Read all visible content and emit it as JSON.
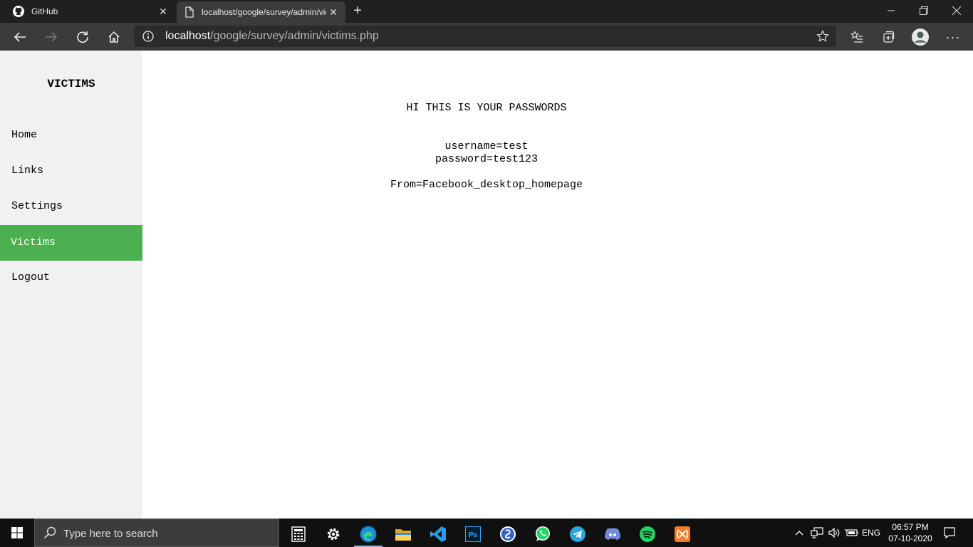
{
  "browser": {
    "tabs": [
      {
        "title": "GitHub",
        "icon": "github-icon"
      },
      {
        "title": "localhost/google/survey/admin/victims.php",
        "icon": "page-icon"
      }
    ],
    "address": {
      "host": "localhost",
      "path": "/google/survey/admin/victims.php"
    }
  },
  "sidebar": {
    "brand": "VICTIMS",
    "items": [
      {
        "label": "Home"
      },
      {
        "label": "Links"
      },
      {
        "label": "Settings"
      },
      {
        "label": "Victims",
        "active": true
      },
      {
        "label": "Logout"
      }
    ],
    "active_color": "#4caf50"
  },
  "main": {
    "heading": "HI THIS IS YOUR PASSWORDS",
    "username": "username=test",
    "password": "password=test123",
    "source": "From=Facebook_desktop_homepage"
  },
  "taskbar": {
    "search_placeholder": "Type here to search",
    "apps": [
      "calculator-icon",
      "settings-icon",
      "edge-icon",
      "file-explorer-icon",
      "vscode-icon",
      "photoshop-icon",
      "simplenote-icon",
      "whatsapp-icon",
      "telegram-icon",
      "discord-icon",
      "spotify-icon",
      "xampp-icon"
    ],
    "language": "ENG",
    "time": "06:57 PM",
    "date": "07-10-2020"
  }
}
